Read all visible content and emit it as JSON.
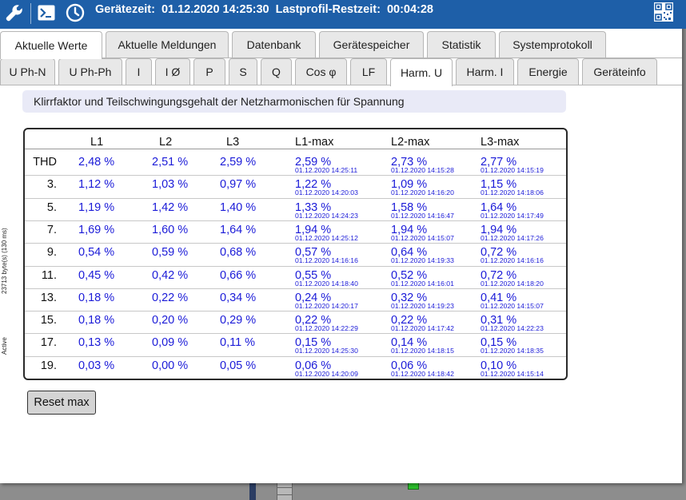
{
  "topbar": {
    "device_time_label": "Gerätezeit:",
    "device_time": "01.12.2020 14:25:30",
    "loadprofile_label": "Lastprofil-Restzeit:",
    "loadprofile_time": "00:04:28",
    "color": "#1e5fa8"
  },
  "main_tabs": [
    "Aktuelle Werte",
    "Aktuelle Meldungen",
    "Datenbank",
    "Gerätespeicher",
    "Statistik",
    "Systemprotokoll"
  ],
  "sub_tabs": [
    "U Ph-N",
    "U Ph-Ph",
    "I",
    "I Ø",
    "P",
    "S",
    "Q",
    "Cos φ",
    "LF",
    "Harm. U",
    "Harm. I",
    "Energie",
    "Geräteinfo"
  ],
  "active_main_tab": "Aktuelle Werte",
  "active_sub_tab": "Harm. U",
  "caption": "Klirrfaktor und Teilschwingungsgehalt der Netzharmonischen für Spannung",
  "table": {
    "headers": [
      "L1",
      "L2",
      "L3",
      "L1-max",
      "L2-max",
      "L3-max"
    ],
    "rows": [
      {
        "label": "THD",
        "l1": "2,48 %",
        "l2": "2,51 %",
        "l3": "2,59 %",
        "l1max": "2,59 %",
        "l1max_t": "01.12.2020 14:25:11",
        "l2max": "2,73 %",
        "l2max_t": "01.12.2020 14:15:28",
        "l3max": "2,77 %",
        "l3max_t": "01.12.2020 14:15:19"
      },
      {
        "label": "3.",
        "l1": "1,12 %",
        "l2": "1,03 %",
        "l3": "0,97 %",
        "l1max": "1,22 %",
        "l1max_t": "01.12.2020 14:20:03",
        "l2max": "1,09 %",
        "l2max_t": "01.12.2020 14:16:20",
        "l3max": "1,15 %",
        "l3max_t": "01.12.2020 14:18:06"
      },
      {
        "label": "5.",
        "l1": "1,19 %",
        "l2": "1,42 %",
        "l3": "1,40 %",
        "l1max": "1,33 %",
        "l1max_t": "01.12.2020 14:24:23",
        "l2max": "1,58 %",
        "l2max_t": "01.12.2020 14:16:47",
        "l3max": "1,64 %",
        "l3max_t": "01.12.2020 14:17:49"
      },
      {
        "label": "7.",
        "l1": "1,69 %",
        "l2": "1,60 %",
        "l3": "1,64 %",
        "l1max": "1,94 %",
        "l1max_t": "01.12.2020 14:25:12",
        "l2max": "1,94 %",
        "l2max_t": "01.12.2020 14:15:07",
        "l3max": "1,94 %",
        "l3max_t": "01.12.2020 14:17:26"
      },
      {
        "label": "9.",
        "l1": "0,54 %",
        "l2": "0,59 %",
        "l3": "0,68 %",
        "l1max": "0,57 %",
        "l1max_t": "01.12.2020 14:16:16",
        "l2max": "0,64 %",
        "l2max_t": "01.12.2020 14:19:33",
        "l3max": "0,72 %",
        "l3max_t": "01.12.2020 14:16:16"
      },
      {
        "label": "11.",
        "l1": "0,45 %",
        "l2": "0,42 %",
        "l3": "0,66 %",
        "l1max": "0,55 %",
        "l1max_t": "01.12.2020 14:18:40",
        "l2max": "0,52 %",
        "l2max_t": "01.12.2020 14:16:01",
        "l3max": "0,72 %",
        "l3max_t": "01.12.2020 14:18:20"
      },
      {
        "label": "13.",
        "l1": "0,18 %",
        "l2": "0,22 %",
        "l3": "0,34 %",
        "l1max": "0,24 %",
        "l1max_t": "01.12.2020 14:20:17",
        "l2max": "0,32 %",
        "l2max_t": "01.12.2020 14:19:23",
        "l3max": "0,41 %",
        "l3max_t": "01.12.2020 14:15:07"
      },
      {
        "label": "15.",
        "l1": "0,18 %",
        "l2": "0,20 %",
        "l3": "0,29 %",
        "l1max": "0,22 %",
        "l1max_t": "01.12.2020 14:22:29",
        "l2max": "0,22 %",
        "l2max_t": "01.12.2020 14:17:42",
        "l3max": "0,31 %",
        "l3max_t": "01.12.2020 14:22:23"
      },
      {
        "label": "17.",
        "l1": "0,13 %",
        "l2": "0,09 %",
        "l3": "0,11 %",
        "l1max": "0,15 %",
        "l1max_t": "01.12.2020 14:25:30",
        "l2max": "0,14 %",
        "l2max_t": "01.12.2020 14:18:15",
        "l3max": "0,15 %",
        "l3max_t": "01.12.2020 14:18:35"
      },
      {
        "label": "19.",
        "l1": "0,03 %",
        "l2": "0,00 %",
        "l3": "0,05 %",
        "l1max": "0,06 %",
        "l1max_t": "01.12.2020 14:20:09",
        "l2max": "0,06 %",
        "l2max_t": "01.12.2020 14:18:42",
        "l3max": "0,10 %",
        "l3max_t": "01.12.2020 14:15:14"
      }
    ]
  },
  "reset_button": "Reset max",
  "side_labels": {
    "bytes": "23713 byte(s) (130 ms)",
    "active": "Active"
  },
  "icons": {
    "settings": "wrench-icon",
    "terminal": "terminal-icon",
    "clock": "clock-icon",
    "qr": "qr-code-icon"
  },
  "colors": {
    "value_text": "#1a1ad8",
    "caption_bg": "#e9eaf7"
  }
}
